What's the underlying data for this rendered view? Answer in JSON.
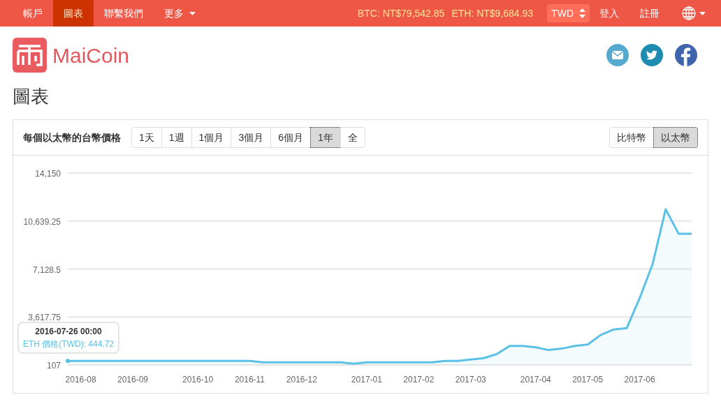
{
  "navbar": {
    "items": [
      {
        "label": "帳戶",
        "selected": false,
        "dropdown": false
      },
      {
        "label": "圖表",
        "selected": true,
        "dropdown": false
      },
      {
        "label": "聯繫我們",
        "selected": false,
        "dropdown": false
      },
      {
        "label": "更多",
        "selected": false,
        "dropdown": true
      }
    ],
    "prices": [
      "BTC: NT$79,542.85",
      "ETH: NT$9,684.93"
    ],
    "currency": "TWD",
    "login": "登入",
    "register": "註冊"
  },
  "brand": "MaiCoin",
  "page_title": "圖表",
  "chart_panel": {
    "title": "每個以太幣的台幣價格",
    "ranges": [
      {
        "label": "1天",
        "selected": false
      },
      {
        "label": "1週",
        "selected": false
      },
      {
        "label": "1個月",
        "selected": false
      },
      {
        "label": "3個月",
        "selected": false
      },
      {
        "label": "6個月",
        "selected": false
      },
      {
        "label": "1年",
        "selected": true
      },
      {
        "label": "全",
        "selected": false
      }
    ],
    "coins": [
      {
        "label": "比特幣",
        "selected": false
      },
      {
        "label": "以太幣",
        "selected": true
      }
    ],
    "tooltip": {
      "title": "2016-07-26 00:00",
      "value": "ETH 價格(TWD): 444.72"
    },
    "chart_data": {
      "type": "area",
      "categories": [
        null,
        "2016-08",
        null,
        null,
        null,
        "2016-09",
        null,
        null,
        null,
        null,
        "2016-10",
        null,
        null,
        null,
        "2016-11",
        null,
        null,
        null,
        "2016-12",
        null,
        null,
        null,
        null,
        "2017-01",
        null,
        null,
        null,
        "2017-02",
        null,
        null,
        null,
        "2017-03",
        null,
        null,
        null,
        null,
        "2017-04",
        null,
        null,
        null,
        "2017-05",
        null,
        null,
        null,
        "2017-06",
        null,
        null,
        null,
        null
      ],
      "series": [
        {
          "color": "#5bc0e6",
          "values": [
            400,
            400,
            400,
            400,
            400,
            400,
            400,
            400,
            400,
            400,
            400,
            400,
            400,
            400,
            400,
            300,
            300,
            300,
            300,
            300,
            300,
            300,
            200,
            300,
            300,
            300,
            300,
            300,
            300,
            400,
            400,
            500,
            600,
            900,
            1500,
            1500,
            1400,
            1200,
            1300,
            1500,
            1600,
            2300,
            2700,
            2800,
            5000,
            7500,
            11500,
            9700,
            9700
          ]
        }
      ],
      "ylim": [
        107,
        14150
      ],
      "grid": true,
      "yticks": [
        {
          "value": 107,
          "label": "107"
        },
        {
          "value": 3617.75,
          "label": "3,617.75"
        },
        {
          "value": 7128.5,
          "label": "7,128.5"
        },
        {
          "value": 10639.25,
          "label": "10,639.25"
        },
        {
          "value": 14150,
          "label": "14,150"
        }
      ]
    }
  }
}
